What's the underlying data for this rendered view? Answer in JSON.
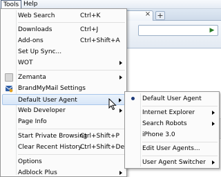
{
  "menubar": {
    "tools": "Tools",
    "help": "Help"
  },
  "tabs": {
    "close_glyph": "×",
    "new_tab_glyph": "+"
  },
  "tools_menu": {
    "items": [
      {
        "label": "Web Search",
        "shortcut": "Ctrl+K"
      },
      {
        "label": "Downloads",
        "shortcut": "Ctrl+J"
      },
      {
        "label": "Add-ons",
        "shortcut": "Ctrl+Shift+A"
      },
      {
        "label": "Set Up Sync..."
      },
      {
        "label": "WOT",
        "submenu": true
      },
      {
        "label": "Zemanta",
        "submenu": true,
        "icon": "zemanta-icon"
      },
      {
        "label": "BrandMyMail Settings",
        "icon": "brandmymail-icon"
      },
      {
        "label": "Default User Agent",
        "submenu": true,
        "highlighted": true
      },
      {
        "label": "Web Developer",
        "submenu": true
      },
      {
        "label": "Page Info"
      },
      {
        "label": "Start Private Browsing",
        "shortcut": "Ctrl+Shift+P"
      },
      {
        "label": "Clear Recent History...",
        "shortcut": "Ctrl+Shift+Del"
      },
      {
        "label": "Options"
      },
      {
        "label": "Adblock Plus",
        "submenu": true
      }
    ]
  },
  "user_agent_menu": {
    "items": [
      {
        "label": "Default User Agent",
        "selected": true
      },
      {
        "label": "Internet Explorer",
        "submenu": true
      },
      {
        "label": "Search Robots",
        "submenu": true
      },
      {
        "label": "iPhone 3.0"
      },
      {
        "label": "Edit User Agents..."
      },
      {
        "label": "User Agent Switcher",
        "submenu": true
      }
    ]
  },
  "colors": {
    "highlight": "#d7e6f8",
    "highlight_border": "#a8c6ea",
    "menu_bg": "#fbfbfb",
    "radio": "#1d3a7a"
  }
}
